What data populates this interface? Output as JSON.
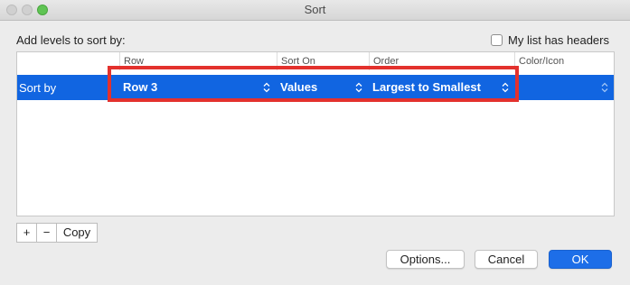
{
  "window": {
    "title": "Sort"
  },
  "header": {
    "add_levels_label": "Add levels to sort by:",
    "my_list_has_headers_label": "My list has headers",
    "my_list_has_headers_checked": false
  },
  "grid": {
    "columns": [
      "Row",
      "Sort On",
      "Order",
      "Color/Icon"
    ],
    "rows": [
      {
        "label": "Sort by",
        "row": "Row 3",
        "sort_on": "Values",
        "order": "Largest to Smallest",
        "color_icon": ""
      }
    ]
  },
  "level_buttons": {
    "add": "+",
    "remove": "−",
    "copy": "Copy"
  },
  "actions": {
    "options": "Options...",
    "cancel": "Cancel",
    "ok": "OK"
  },
  "colors": {
    "selection": "#1165e1",
    "highlight": "#e3312d",
    "ok": "#1d6ee8"
  },
  "icons": [
    "updown-chevron-icon",
    "add-icon",
    "remove-icon"
  ]
}
